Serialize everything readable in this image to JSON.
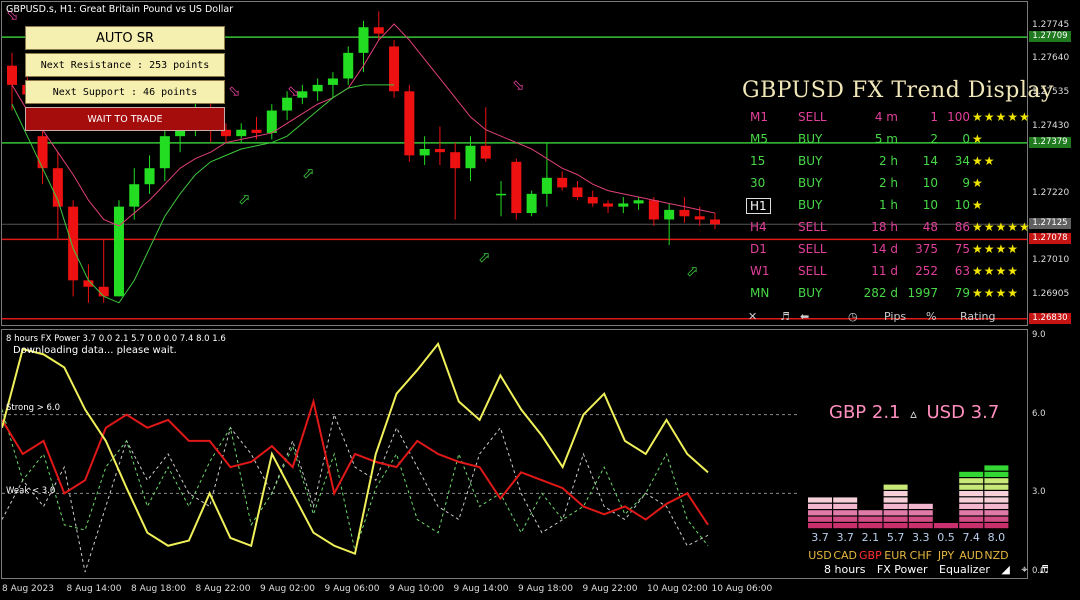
{
  "chart": {
    "title": "GBPUSD.s, H1:  Great Britain Pound vs US Dollar",
    "price_axis": [
      "1.27745",
      "1.27640",
      "1.27535",
      "1.27430",
      "1.27220",
      "1.27010",
      "1.26905"
    ],
    "price_tags": [
      {
        "value": "1.27709",
        "color": "#1f7a1f"
      },
      {
        "value": "1.27379",
        "color": "#1f7a1f"
      },
      {
        "value": "1.27125",
        "color": "#606060"
      },
      {
        "value": "1.27078",
        "color": "#c41414"
      },
      {
        "value": "1.26830",
        "color": "#c41414"
      }
    ],
    "date_axis": [
      "8 Aug 2023",
      "8 Aug 14:00",
      "8 Aug 18:00",
      "8 Aug 22:00",
      "9 Aug 02:00",
      "9 Aug 06:00",
      "9 Aug 10:00",
      "9 Aug 14:00",
      "9 Aug 18:00",
      "9 Aug 22:00",
      "10 Aug 02:00",
      "10 Aug 06:00"
    ],
    "candles": [
      {
        "o": 1.2762,
        "h": 1.2766,
        "l": 1.2748,
        "c": 1.2756
      },
      {
        "o": 1.2756,
        "h": 1.276,
        "l": 1.2751,
        "c": 1.2753
      },
      {
        "o": 1.274,
        "h": 1.2745,
        "l": 1.2725,
        "c": 1.273
      },
      {
        "o": 1.273,
        "h": 1.2735,
        "l": 1.2708,
        "c": 1.2718
      },
      {
        "o": 1.2718,
        "h": 1.272,
        "l": 1.269,
        "c": 1.2695
      },
      {
        "o": 1.2695,
        "h": 1.27,
        "l": 1.2688,
        "c": 1.2693
      },
      {
        "o": 1.2693,
        "h": 1.2708,
        "l": 1.2688,
        "c": 1.269
      },
      {
        "o": 1.269,
        "h": 1.272,
        "l": 1.269,
        "c": 1.2718
      },
      {
        "o": 1.2718,
        "h": 1.273,
        "l": 1.2714,
        "c": 1.2725
      },
      {
        "o": 1.2725,
        "h": 1.2734,
        "l": 1.2722,
        "c": 1.273
      },
      {
        "o": 1.273,
        "h": 1.2745,
        "l": 1.2726,
        "c": 1.274
      },
      {
        "o": 1.274,
        "h": 1.2748,
        "l": 1.2735,
        "c": 1.2745
      },
      {
        "o": 1.2745,
        "h": 1.2752,
        "l": 1.274,
        "c": 1.2747
      },
      {
        "o": 1.2747,
        "h": 1.275,
        "l": 1.2738,
        "c": 1.2742
      },
      {
        "o": 1.2742,
        "h": 1.2744,
        "l": 1.2738,
        "c": 1.274
      },
      {
        "o": 1.274,
        "h": 1.2744,
        "l": 1.2738,
        "c": 1.2742
      },
      {
        "o": 1.2742,
        "h": 1.2746,
        "l": 1.2739,
        "c": 1.2741
      },
      {
        "o": 1.2741,
        "h": 1.275,
        "l": 1.2739,
        "c": 1.2748
      },
      {
        "o": 1.2748,
        "h": 1.2754,
        "l": 1.2745,
        "c": 1.2752
      },
      {
        "o": 1.2752,
        "h": 1.2756,
        "l": 1.275,
        "c": 1.2754
      },
      {
        "o": 1.2754,
        "h": 1.2758,
        "l": 1.2751,
        "c": 1.2756
      },
      {
        "o": 1.2756,
        "h": 1.276,
        "l": 1.2752,
        "c": 1.2758
      },
      {
        "o": 1.2758,
        "h": 1.2768,
        "l": 1.2756,
        "c": 1.2766
      },
      {
        "o": 1.2766,
        "h": 1.2776,
        "l": 1.276,
        "c": 1.2774
      },
      {
        "o": 1.2774,
        "h": 1.2779,
        "l": 1.277,
        "c": 1.2772
      },
      {
        "o": 1.2768,
        "h": 1.277,
        "l": 1.2752,
        "c": 1.2754
      },
      {
        "o": 1.2754,
        "h": 1.2756,
        "l": 1.2732,
        "c": 1.2734
      },
      {
        "o": 1.2734,
        "h": 1.274,
        "l": 1.2731,
        "c": 1.2736
      },
      {
        "o": 1.2736,
        "h": 1.2743,
        "l": 1.2731,
        "c": 1.2735
      },
      {
        "o": 1.2735,
        "h": 1.2738,
        "l": 1.2714,
        "c": 1.273
      },
      {
        "o": 1.273,
        "h": 1.274,
        "l": 1.2726,
        "c": 1.2737
      },
      {
        "o": 1.2737,
        "h": 1.2749,
        "l": 1.2732,
        "c": 1.2733
      },
      {
        "o": 1.2722,
        "h": 1.2726,
        "l": 1.2715,
        "c": 1.2722
      },
      {
        "o": 1.2732,
        "h": 1.2733,
        "l": 1.2714,
        "c": 1.2716
      },
      {
        "o": 1.2716,
        "h": 1.2723,
        "l": 1.2715,
        "c": 1.2722
      },
      {
        "o": 1.2722,
        "h": 1.2738,
        "l": 1.2718,
        "c": 1.2727
      },
      {
        "o": 1.2727,
        "h": 1.2729,
        "l": 1.2723,
        "c": 1.2724
      },
      {
        "o": 1.2724,
        "h": 1.2726,
        "l": 1.272,
        "c": 1.2721
      },
      {
        "o": 1.2721,
        "h": 1.2723,
        "l": 1.2718,
        "c": 1.2719
      },
      {
        "o": 1.2719,
        "h": 1.272,
        "l": 1.2716,
        "c": 1.2718
      },
      {
        "o": 1.2718,
        "h": 1.2721,
        "l": 1.2716,
        "c": 1.2719
      },
      {
        "o": 1.2719,
        "h": 1.2721,
        "l": 1.2717,
        "c": 1.272
      },
      {
        "o": 1.272,
        "h": 1.2721,
        "l": 1.2712,
        "c": 1.2714
      },
      {
        "o": 1.2714,
        "h": 1.2719,
        "l": 1.2706,
        "c": 1.2717
      },
      {
        "o": 1.2717,
        "h": 1.2721,
        "l": 1.2713,
        "c": 1.2715
      },
      {
        "o": 1.2715,
        "h": 1.2718,
        "l": 1.2712,
        "c": 1.2714
      },
      {
        "o": 1.2714,
        "h": 1.2716,
        "l": 1.2711,
        "c": 1.27125
      }
    ]
  },
  "sr": {
    "title": "AUTO SR",
    "resistance": "Next Resistance : 253 points",
    "support": "Next Support : 46 points",
    "signal": "WAIT TO TRADE"
  },
  "trend": {
    "title": "GBPUSD FX Trend Display",
    "rows": [
      {
        "tf": "M1",
        "dir": "SELL",
        "dur": "4 m",
        "pips": "1",
        "pct": "100",
        "stars": "★★★★★",
        "color": "#e0409a"
      },
      {
        "tf": "M5",
        "dir": "BUY",
        "dur": "5 m",
        "pips": "2",
        "pct": "0",
        "stars": "★",
        "color": "#48d848"
      },
      {
        "tf": "15",
        "dir": "BUY",
        "dur": "2 h",
        "pips": "14",
        "pct": "34",
        "stars": "★★",
        "color": "#48d848"
      },
      {
        "tf": "30",
        "dir": "BUY",
        "dur": "2 h",
        "pips": "10",
        "pct": "9",
        "stars": "★",
        "color": "#48d848"
      },
      {
        "tf": "H1",
        "dir": "BUY",
        "dur": "1 h",
        "pips": "10",
        "pct": "10",
        "stars": "★",
        "color": "#48d848",
        "boxed": true
      },
      {
        "tf": "H4",
        "dir": "SELL",
        "dur": "18 h",
        "pips": "48",
        "pct": "86",
        "stars": "★★★★★",
        "color": "#e0409a"
      },
      {
        "tf": "D1",
        "dir": "SELL",
        "dur": "14 d",
        "pips": "375",
        "pct": "75",
        "stars": "★★★★",
        "color": "#e0409a"
      },
      {
        "tf": "W1",
        "dir": "SELL",
        "dur": "11 d",
        "pips": "252",
        "pct": "63",
        "stars": "★★★★",
        "color": "#e0409a"
      },
      {
        "tf": "MN",
        "dir": "BUY",
        "dur": "282 d",
        "pips": "1997",
        "pct": "79",
        "stars": "★★★★",
        "color": "#48d848"
      }
    ],
    "footer": {
      "close": "✕",
      "pips": "Pips",
      "pct": "%",
      "rating": "Rating"
    }
  },
  "power": {
    "title": "8 hours FX Power 3.7 0.0 2.1 5.7 0.0 0.0 7.4 8.0 1.6",
    "note": "Downloading data... please wait.",
    "strong_label": "Strong > 6.0",
    "weak_label": "Weak < 3.0",
    "axis": [
      "9.0",
      "6.0",
      "3.0",
      "0.0"
    ],
    "pair_base": "GBP 2.1",
    "pair_quote": "USD 3.7",
    "pair_sep": "▵",
    "equalizer": [
      {
        "cur": "USD",
        "val": "3.7",
        "v": 3.7
      },
      {
        "cur": "CAD",
        "val": "3.7",
        "v": 3.7
      },
      {
        "cur": "GBP",
        "val": "2.1",
        "v": 2.1,
        "highlight": true
      },
      {
        "cur": "EUR",
        "val": "5.7",
        "v": 5.7
      },
      {
        "cur": "CHF",
        "val": "3.3",
        "v": 3.3
      },
      {
        "cur": "JPY",
        "val": "0.5",
        "v": 0.5
      },
      {
        "cur": "AUD",
        "val": "7.4",
        "v": 7.4
      },
      {
        "cur": "NZD",
        "val": "8.0",
        "v": 8.0
      }
    ],
    "footer": {
      "period": "8 hours",
      "name": "FX Power",
      "mode": "Equalizer"
    },
    "series_yellow": [
      5.5,
      8.5,
      8.3,
      7.8,
      6.2,
      5.0,
      3.2,
      1.5,
      1.0,
      1.2,
      3.0,
      1.3,
      1.0,
      4.5,
      3.0,
      1.5,
      1.0,
      0.7,
      4.5,
      6.8,
      7.7,
      8.7,
      6.5,
      5.8,
      7.5,
      6.2,
      5.2,
      4.0,
      6.0,
      6.8,
      5.0,
      4.5,
      5.8,
      4.5,
      3.8
    ],
    "series_red": [
      5.8,
      4.5,
      5.0,
      3.0,
      3.5,
      5.5,
      6.0,
      5.5,
      5.8,
      5.0,
      5.0,
      4.0,
      4.2,
      4.8,
      4.0,
      6.5,
      3.0,
      4.5,
      4.2,
      4.0,
      5.0,
      4.5,
      4.2,
      4.0,
      2.8,
      3.8,
      3.5,
      3.2,
      2.5,
      2.2,
      2.5,
      2.0,
      2.6,
      3.0,
      1.8
    ],
    "series_green_dash": [
      6.2,
      3.5,
      4.5,
      1.8,
      1.6,
      4.0,
      5.0,
      2.5,
      4.0,
      2.5,
      4.2,
      5.5,
      1.8,
      3.0,
      4.8,
      2.2,
      4.5,
      0.8,
      3.2,
      4.5,
      2.0,
      1.5,
      4.5,
      2.5,
      3.0,
      1.5,
      3.0,
      2.0,
      2.5,
      4.0,
      2.2,
      3.0,
      4.5,
      2.0,
      1.0
    ],
    "series_white_dash": [
      2.0,
      3.5,
      2.5,
      4.0,
      0.0,
      2.5,
      5.0,
      3.5,
      4.5,
      3.0,
      2.5,
      5.5,
      4.5,
      3.0,
      5.0,
      2.5,
      6.0,
      4.0,
      3.5,
      5.5,
      4.0,
      2.5,
      2.0,
      4.5,
      5.5,
      3.0,
      1.5,
      2.0,
      4.5,
      2.5,
      2.0,
      3.0,
      2.5,
      1.0,
      1.4
    ]
  }
}
